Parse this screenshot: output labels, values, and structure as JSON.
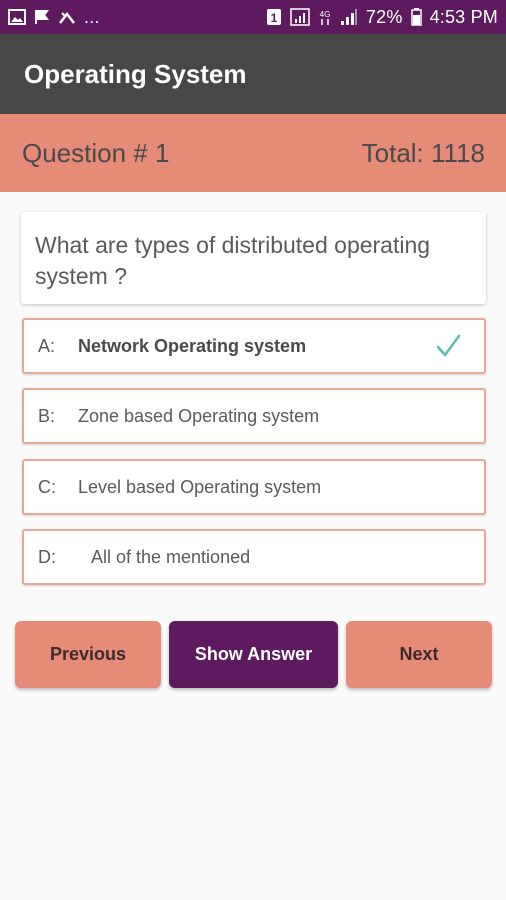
{
  "status_bar": {
    "left_ellipsis": "...",
    "battery_percent": "72%",
    "time": "4:53 PM",
    "network_type": "4G",
    "sim_badge": "1"
  },
  "app_bar": {
    "title": "Operating System"
  },
  "question_header": {
    "number_label": "Question # 1",
    "total_label": "Total: 1118"
  },
  "question": {
    "text": "What are types of distributed operating system ?"
  },
  "options": [
    {
      "letter": "A:",
      "text": "Network Operating system",
      "selected_correct": true
    },
    {
      "letter": "B:",
      "text": "Zone based Operating system",
      "selected_correct": false
    },
    {
      "letter": "C:",
      "text": "Level based Operating system",
      "selected_correct": false
    },
    {
      "letter": "D:",
      "text": "All of the mentioned",
      "selected_correct": false
    }
  ],
  "buttons": {
    "previous": "Previous",
    "show_answer": "Show Answer",
    "next": "Next"
  },
  "colors": {
    "status_bar": "#5e1a5e",
    "app_bar": "#474747",
    "accent_salmon": "#e58b77",
    "primary_purple": "#5e1a5e",
    "check_teal": "#5bbcb0"
  }
}
